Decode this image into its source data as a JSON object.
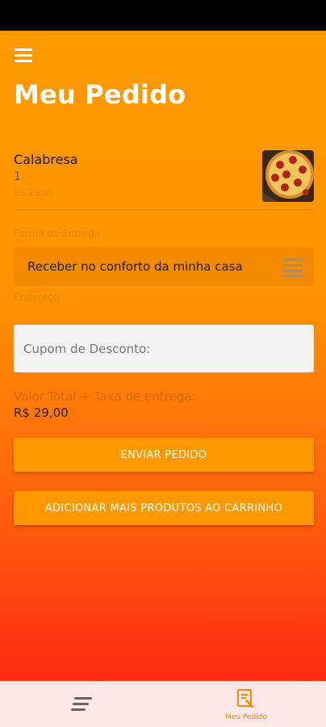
{
  "header": {
    "title": "Meu Pedido"
  },
  "cart": {
    "items": [
      {
        "name": "Calabresa",
        "quantity": "1",
        "price": "R$ 29,00"
      }
    ]
  },
  "delivery": {
    "label": "Forma de Entrega",
    "selected": "Receber no conforto da minha casa"
  },
  "address": {
    "label": "Endereço"
  },
  "coupon": {
    "placeholder": "Cupom de Desconto:"
  },
  "total": {
    "label": "Valor Total + Taxa de entrega:",
    "value": "R$ 29,00"
  },
  "buttons": {
    "send": "ENVIAR PEDIDO",
    "add_more": "ADICIONAR MAIS PRODUTOS AO CARRINHO"
  },
  "bottom_nav": {
    "items": [
      {
        "icon": "menu-lines-icon",
        "label": ""
      },
      {
        "icon": "order-icon",
        "label": "Meu Pedido"
      }
    ]
  },
  "colors": {
    "accent": "#ff9800",
    "nav_active": "#ff8a00",
    "gradient_top": "#ff9a00",
    "gradient_bottom": "#ff2a12"
  }
}
